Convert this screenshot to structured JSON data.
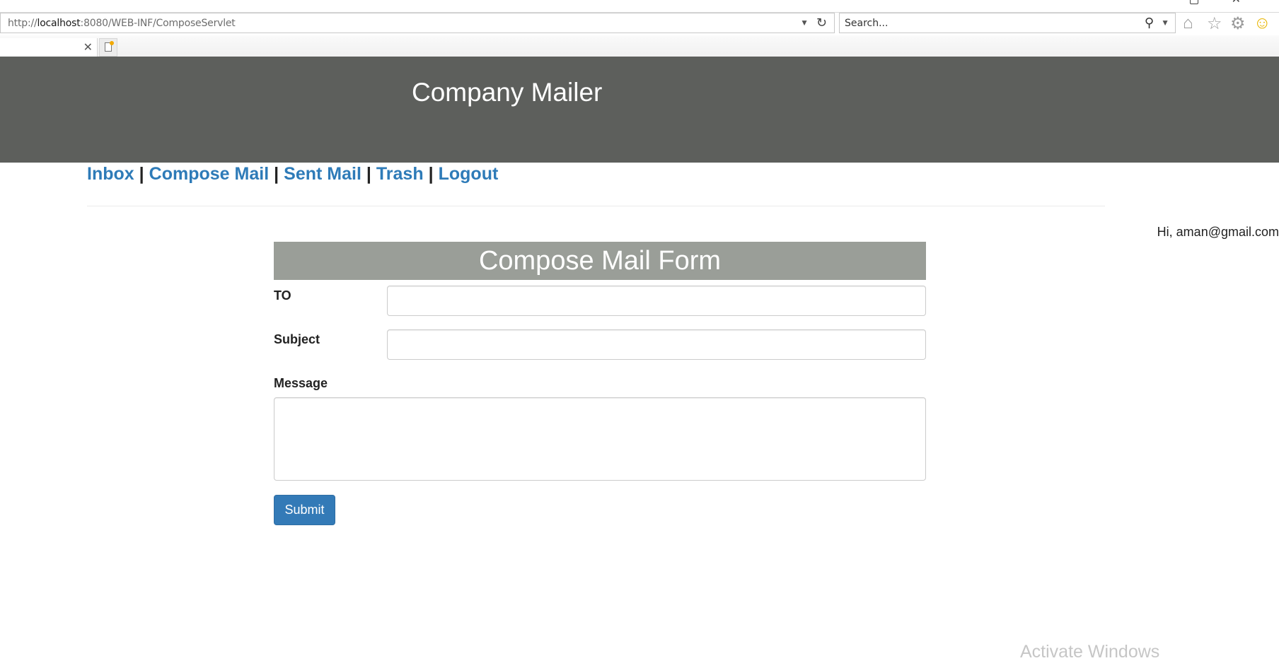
{
  "browser": {
    "url_prefix": "http://",
    "url_host": "localhost",
    "url_rest": ":8080/WEB-INF/ComposeServlet",
    "search_placeholder": "Search...",
    "icons": {
      "dropdown": "chevron-down-icon",
      "refresh": "refresh-icon",
      "search": "search-icon",
      "home": "home-icon",
      "favorites": "star-icon",
      "tools": "gear-icon",
      "feedback": "smiley-icon",
      "tab_close": "close-icon",
      "new_tab": "new-tab-icon"
    }
  },
  "site": {
    "title": "Company Mailer",
    "header_color": "#5d5f5c"
  },
  "nav": {
    "items": [
      {
        "label": "Inbox"
      },
      {
        "label": "Compose Mail"
      },
      {
        "label": "Sent Mail"
      },
      {
        "label": "Trash"
      },
      {
        "label": "Logout"
      }
    ],
    "separator": "|",
    "link_color": "#2e7bb8"
  },
  "user": {
    "greeting": "Hi, aman@gmail.com"
  },
  "compose_form": {
    "title": "Compose Mail Form",
    "to_label": "TO",
    "to_value": "",
    "subject_label": "Subject",
    "subject_value": "",
    "message_label": "Message",
    "message_value": "",
    "submit_label": "Submit",
    "submit_color": "#337ab7"
  },
  "os": {
    "watermark": "Activate Windows"
  }
}
